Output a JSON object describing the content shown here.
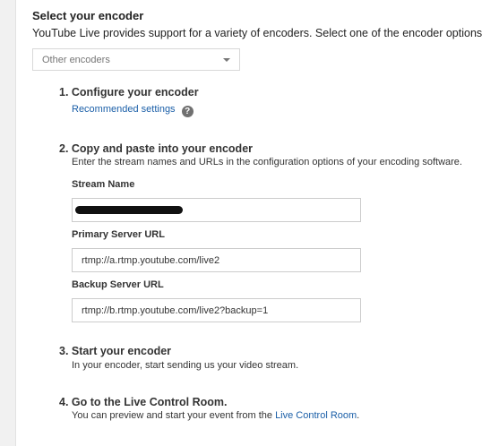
{
  "section": {
    "title": "Select your encoder",
    "intro": "YouTube Live provides support for a variety of encoders. Select one of the encoder options"
  },
  "encoder_select": {
    "selected": "Other encoders"
  },
  "steps": [
    {
      "title": "1. Configure your encoder",
      "link": "Recommended settings",
      "help_icon": "?"
    },
    {
      "title": "2. Copy and paste into your encoder",
      "desc": "Enter the stream names and URLs in the configuration options of your encoding software.",
      "fields": [
        {
          "label": "Stream Name",
          "value": ""
        },
        {
          "label": "Primary Server URL",
          "value": "rtmp://a.rtmp.youtube.com/live2"
        },
        {
          "label": "Backup Server URL",
          "value": "rtmp://b.rtmp.youtube.com/live2?backup=1"
        }
      ]
    },
    {
      "title": "3. Start your encoder",
      "desc": "In your encoder, start sending us your video stream."
    },
    {
      "title": "4. Go to the Live Control Room.",
      "desc_prefix": "You can preview and start your event from the ",
      "desc_link": "Live Control Room",
      "desc_suffix": "."
    }
  ]
}
